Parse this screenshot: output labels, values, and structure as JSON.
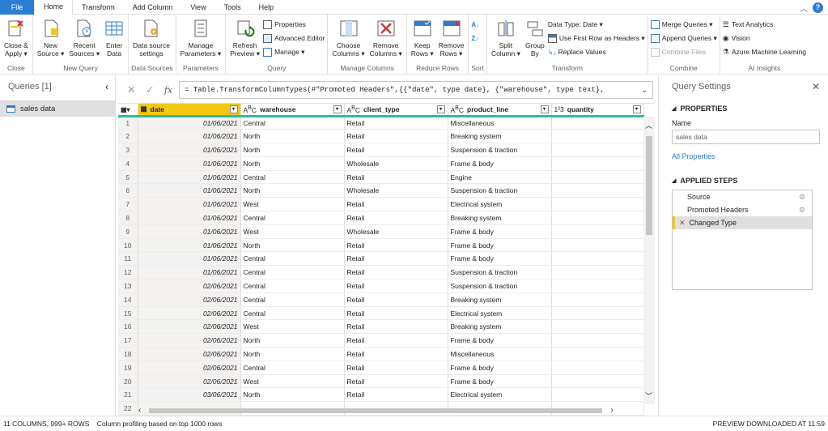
{
  "tabs": [
    "File",
    "Home",
    "Transform",
    "Add Column",
    "View",
    "Tools",
    "Help"
  ],
  "ribbon": {
    "close_apply": "Close &\nApply ▾",
    "new_source": "New\nSource ▾",
    "recent_sources": "Recent\nSources ▾",
    "enter_data": "Enter\nData",
    "data_source_settings": "Data source\nsettings",
    "manage_parameters": "Manage\nParameters ▾",
    "refresh_preview": "Refresh\nPreview ▾",
    "properties": "Properties",
    "advanced_editor": "Advanced Editor",
    "manage": "Manage ▾",
    "choose_columns": "Choose\nColumns ▾",
    "remove_columns": "Remove\nColumns ▾",
    "keep_rows": "Keep\nRows ▾",
    "remove_rows": "Remove\nRows ▾",
    "split_column": "Split\nColumn ▾",
    "group_by": "Group\nBy",
    "data_type": "Data Type: Date ▾",
    "first_row_headers": "Use First Row as Headers ▾",
    "replace_values": "Replace Values",
    "merge_queries": "Merge Queries ▾",
    "append_queries": "Append Queries ▾",
    "combine_files": "Combine Files",
    "text_analytics": "Text Analytics",
    "vision": "Vision",
    "azure_ml": "Azure Machine Learning",
    "groups": {
      "close": "Close",
      "new_query": "New Query",
      "data_sources": "Data Sources",
      "parameters": "Parameters",
      "query": "Query",
      "manage_columns": "Manage Columns",
      "reduce_rows": "Reduce Rows",
      "sort": "Sort",
      "transform": "Transform",
      "combine": "Combine",
      "ai_insights": "AI Insights"
    }
  },
  "queries": {
    "title": "Queries [1]",
    "items": [
      "sales data"
    ]
  },
  "formula": "= Table.TransformColumnTypes(#\"Promoted Headers\",{{\"date\", type date}, {\"warehouse\", type text},",
  "columns": [
    {
      "type": "date",
      "name": "date"
    },
    {
      "type": "ABC",
      "name": "warehouse"
    },
    {
      "type": "ABC",
      "name": "client_type"
    },
    {
      "type": "ABC",
      "name": "product_line"
    },
    {
      "type": "123",
      "name": "quantity"
    }
  ],
  "rows": [
    [
      "1",
      "01/06/2021",
      "Central",
      "Retail",
      "Miscellaneous"
    ],
    [
      "2",
      "01/06/2021",
      "North",
      "Retail",
      "Breaking system"
    ],
    [
      "3",
      "01/06/2021",
      "North",
      "Retail",
      "Suspension & traction"
    ],
    [
      "4",
      "01/06/2021",
      "North",
      "Wholesale",
      "Frame & body"
    ],
    [
      "5",
      "01/06/2021",
      "Central",
      "Retail",
      "Engine"
    ],
    [
      "6",
      "01/06/2021",
      "North",
      "Wholesale",
      "Suspension & traction"
    ],
    [
      "7",
      "01/06/2021",
      "West",
      "Retail",
      "Electrical system"
    ],
    [
      "8",
      "01/06/2021",
      "Central",
      "Retail",
      "Breaking system"
    ],
    [
      "9",
      "01/06/2021",
      "West",
      "Wholesale",
      "Frame & body"
    ],
    [
      "10",
      "01/06/2021",
      "North",
      "Retail",
      "Frame & body"
    ],
    [
      "11",
      "01/06/2021",
      "Central",
      "Retail",
      "Frame & body"
    ],
    [
      "12",
      "01/06/2021",
      "Central",
      "Retail",
      "Suspension & traction"
    ],
    [
      "13",
      "02/06/2021",
      "Central",
      "Retail",
      "Suspension & traction"
    ],
    [
      "14",
      "02/06/2021",
      "Central",
      "Retail",
      "Breaking system"
    ],
    [
      "15",
      "02/06/2021",
      "Central",
      "Retail",
      "Electrical system"
    ],
    [
      "16",
      "02/06/2021",
      "West",
      "Retail",
      "Breaking system"
    ],
    [
      "17",
      "02/06/2021",
      "North",
      "Retail",
      "Frame & body"
    ],
    [
      "18",
      "02/06/2021",
      "North",
      "Retail",
      "Miscellaneous"
    ],
    [
      "19",
      "02/06/2021",
      "Central",
      "Retail",
      "Frame & body"
    ],
    [
      "20",
      "02/06/2021",
      "West",
      "Retail",
      "Frame & body"
    ],
    [
      "21",
      "03/06/2021",
      "North",
      "Retail",
      "Electrical system"
    ],
    [
      "22",
      "",
      "",
      "",
      ""
    ]
  ],
  "settings": {
    "title": "Query Settings",
    "properties": "PROPERTIES",
    "name_label": "Name",
    "name_value": "sales data",
    "all_properties": "All Properties",
    "applied_steps": "APPLIED STEPS",
    "steps": [
      "Source",
      "Promoted Headers",
      "Changed Type"
    ]
  },
  "status": {
    "left": "11 COLUMNS, 999+ ROWS    Column profiling based on top 1000 rows",
    "right": "PREVIEW DOWNLOADED AT 11:59"
  },
  "colors": {
    "accent": "#2b7cd3",
    "selected_header": "#f2c811",
    "quality_bar": "#2fb9a7"
  }
}
